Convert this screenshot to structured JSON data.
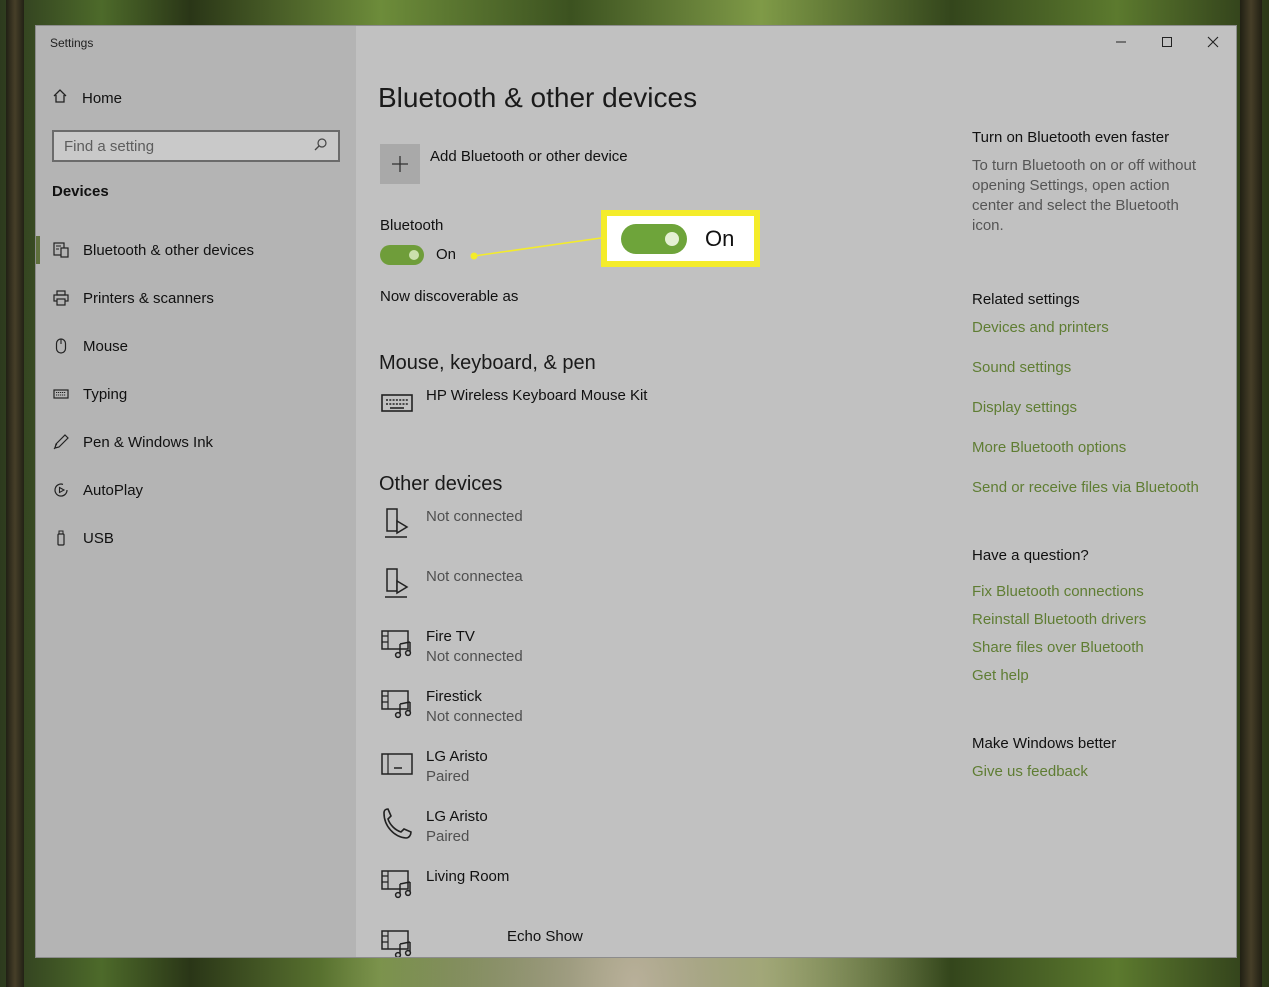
{
  "window": {
    "title": "Settings",
    "controls": {
      "minimize": "—",
      "maximize": "☐",
      "close": "✕"
    }
  },
  "sidebar": {
    "home_label": "Home",
    "search_placeholder": "Find a setting",
    "section_label": "Devices",
    "items": [
      {
        "label": "Bluetooth & other devices",
        "icon": "bluetooth-devices-icon",
        "active": true
      },
      {
        "label": "Printers & scanners",
        "icon": "printer-icon",
        "active": false
      },
      {
        "label": "Mouse",
        "icon": "mouse-icon",
        "active": false
      },
      {
        "label": "Typing",
        "icon": "keyboard-icon",
        "active": false
      },
      {
        "label": "Pen & Windows Ink",
        "icon": "pen-icon",
        "active": false
      },
      {
        "label": "AutoPlay",
        "icon": "autoplay-icon",
        "active": false
      },
      {
        "label": "USB",
        "icon": "usb-icon",
        "active": false
      }
    ]
  },
  "main": {
    "page_title": "Bluetooth & other devices",
    "add_device_label": "Add Bluetooth or other device",
    "bluetooth_label": "Bluetooth",
    "bluetooth_state": "On",
    "discoverable_text": "Now discoverable as",
    "callout_state": "On",
    "mouse_section": {
      "title": "Mouse, keyboard, & pen",
      "devices": [
        {
          "name": "HP Wireless Keyboard Mouse Kit",
          "status": "",
          "icon": "keyboard-icon"
        }
      ]
    },
    "other_section": {
      "title": "Other devices",
      "devices": [
        {
          "name": "",
          "status": "Not connected",
          "icon": "media-device-icon"
        },
        {
          "name": "",
          "status": "Not connectea",
          "icon": "media-device-icon"
        },
        {
          "name": "Fire TV",
          "status": "Not connected",
          "icon": "media-music-icon"
        },
        {
          "name": "Firestick",
          "status": "Not connected",
          "icon": "media-music-icon"
        },
        {
          "name": "LG Aristo",
          "status": "Paired",
          "icon": "tablet-icon"
        },
        {
          "name": "LG Aristo",
          "status": "Paired",
          "icon": "phone-icon"
        },
        {
          "name": "Living Room",
          "status": "",
          "icon": "media-music-icon"
        },
        {
          "name": "Echo Show",
          "status": "",
          "icon": "media-music-icon"
        }
      ]
    }
  },
  "right": {
    "faster_title": "Turn on Bluetooth even faster",
    "faster_body": "To turn Bluetooth on or off without opening Settings, open action center and select the Bluetooth icon.",
    "related_title": "Related settings",
    "related_links": [
      "Devices and printers",
      "Sound settings",
      "Display settings",
      "More Bluetooth options",
      "Send or receive files via Bluetooth"
    ],
    "question_title": "Have a question?",
    "question_links": [
      "Fix Bluetooth connections",
      "Reinstall Bluetooth drivers",
      "Share files over Bluetooth",
      "Get help"
    ],
    "better_title": "Make Windows better",
    "feedback_link": "Give us feedback"
  },
  "colors": {
    "accent_link": "#5f7d33",
    "toggle_on": "#6f9d3a",
    "callout_border": "#f4ec2a"
  }
}
